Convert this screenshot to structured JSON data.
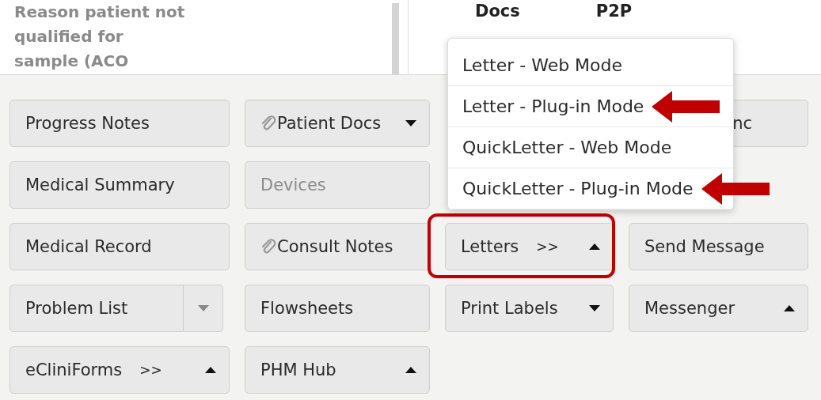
{
  "top_panel": {
    "reason_text": "Reason patient not qualified for sample (ACO",
    "headers": [
      "Docs",
      "P2P"
    ]
  },
  "button_rows": [
    [
      {
        "label": "Progress Notes",
        "kind": "plain",
        "attachment": false,
        "caret": false,
        "disabled": false,
        "highlighted": false
      },
      {
        "label": "Patient Docs",
        "kind": "plain",
        "attachment": true,
        "caret": true,
        "caret_up": false,
        "disabled": false,
        "highlighted": false
      },
      null,
      {
        "label": "nc",
        "kind": "partial",
        "attachment": false,
        "caret": false,
        "disabled": false,
        "highlighted": false
      }
    ],
    [
      {
        "label": "Medical Summary",
        "kind": "plain",
        "attachment": false,
        "caret": false,
        "disabled": false,
        "highlighted": false
      },
      {
        "label": "Devices",
        "kind": "plain",
        "attachment": false,
        "caret": false,
        "disabled": true,
        "highlighted": false
      },
      null,
      null
    ],
    [
      {
        "label": "Medical Record",
        "kind": "plain",
        "attachment": false,
        "caret": false,
        "disabled": false,
        "highlighted": false
      },
      {
        "label": "Consult Notes",
        "kind": "plain",
        "attachment": true,
        "caret": false,
        "disabled": false,
        "highlighted": false
      },
      {
        "label": "Letters",
        "suffix": ">>",
        "kind": "plain",
        "attachment": false,
        "caret": true,
        "caret_up": true,
        "disabled": false,
        "highlighted": true
      },
      {
        "label": "Send Message",
        "kind": "plain",
        "attachment": false,
        "caret": false,
        "disabled": false,
        "highlighted": false
      }
    ],
    [
      {
        "label": "Problem List",
        "kind": "split",
        "attachment": false,
        "caret": false,
        "disabled": false,
        "highlighted": false
      },
      {
        "label": "Flowsheets",
        "kind": "plain",
        "attachment": false,
        "caret": false,
        "disabled": false,
        "highlighted": false
      },
      {
        "label": "Print Labels",
        "kind": "plain",
        "attachment": false,
        "caret": true,
        "caret_up": false,
        "disabled": false,
        "highlighted": false
      },
      {
        "label": "Messenger",
        "kind": "plain",
        "attachment": false,
        "caret": true,
        "caret_up": true,
        "disabled": false,
        "highlighted": false
      }
    ],
    [
      {
        "label": "eCliniForms",
        "suffix": ">>",
        "kind": "plain",
        "attachment": false,
        "caret": true,
        "caret_up": true,
        "disabled": false,
        "highlighted": false
      },
      {
        "label": "PHM Hub",
        "kind": "plain",
        "attachment": false,
        "caret": true,
        "caret_up": true,
        "disabled": false,
        "highlighted": false
      },
      null,
      null
    ]
  ],
  "letters_menu": {
    "items": [
      {
        "label": "Letter - Web Mode",
        "annotated": false
      },
      {
        "label": "Letter - Plug-in Mode",
        "annotated": true
      },
      {
        "label": "QuickLetter - Web Mode",
        "annotated": false
      },
      {
        "label": "QuickLetter - Plug-in Mode",
        "annotated": true
      }
    ]
  }
}
